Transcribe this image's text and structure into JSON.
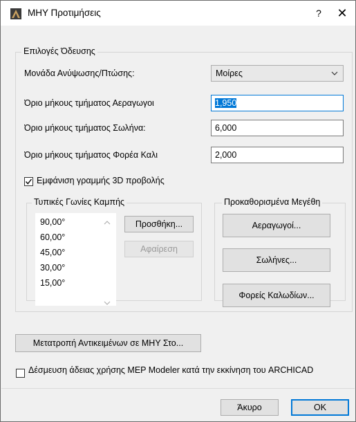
{
  "titlebar": {
    "title": "ΜΗΥ Προτιμήσεις",
    "help_label": "?",
    "close_label": "✕",
    "icon": "archicad-logo-icon"
  },
  "routing": {
    "legend": "Επιλογές Όδευσης",
    "rise_label": "Μονάδα Ανύψωσης/Πτώσης:",
    "rise_value": "Μοίρες",
    "duct_label": "Όριο μήκους τμήματος Αεραγωγοι",
    "duct_value": "1,950",
    "pipe_label": "Όριο μήκους τμήματος Σωλήνα:",
    "pipe_value": "6,000",
    "cable_label": "Όριο μήκους τμήματος Φορέα Καλι",
    "cable_value": "2,000",
    "show3d_label": "Εμφάνιση γραμμής 3D προβολής",
    "show3d_checked": true
  },
  "bend": {
    "legend": "Τυπικές Γωνίες Καμπής",
    "items": [
      "90,00°",
      "60,00°",
      "45,00°",
      "30,00°",
      "15,00°"
    ],
    "add_label": "Προσθήκη...",
    "remove_label": "Αφαίρεση"
  },
  "preset": {
    "legend": "Προκαθορισμένα Μεγέθη",
    "ducts_label": "Αεραγωγοί...",
    "pipes_label": "Σωλήνες...",
    "cables_label": "Φορείς Καλωδίων..."
  },
  "convert_label": "Μετατροπή Αντικειμένων σε ΜΗΥ Στο...",
  "license_label": "Δέσμευση άδειας χρήσης MEP Modeler κατά την εκκίνηση του ARCHICAD",
  "license_checked": false,
  "footer": {
    "cancel_label": "Άκυρο",
    "ok_label": "OK"
  },
  "colors": {
    "accent": "#0078d7",
    "background": "#f0f0f0"
  }
}
